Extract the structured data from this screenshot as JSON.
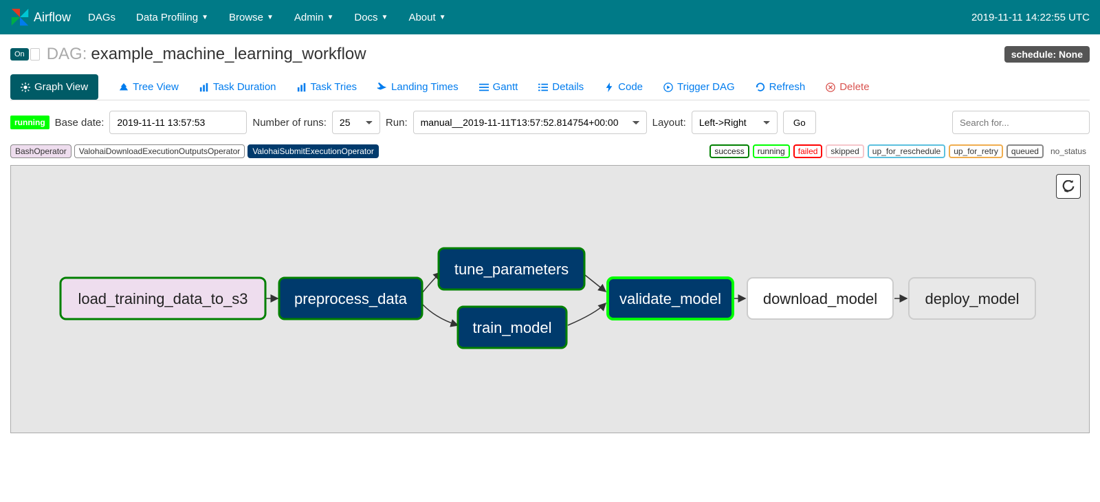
{
  "navbar": {
    "brand": "Airflow",
    "items": [
      "DAGs",
      "Data Profiling",
      "Browse",
      "Admin",
      "Docs",
      "About"
    ],
    "clock": "2019-11-11 14:22:55 UTC"
  },
  "title": {
    "on": "On",
    "dag_label": "DAG:",
    "dag_name": "example_machine_learning_workflow",
    "schedule": "schedule: None"
  },
  "tabs": {
    "graph_view": "Graph View",
    "tree_view": "Tree View",
    "task_duration": "Task Duration",
    "task_tries": "Task Tries",
    "landing_times": "Landing Times",
    "gantt": "Gantt",
    "details": "Details",
    "code": "Code",
    "trigger_dag": "Trigger DAG",
    "refresh": "Refresh",
    "delete": "Delete"
  },
  "controls": {
    "running": "running",
    "base_date_label": "Base date:",
    "base_date": "2019-11-11 13:57:53",
    "num_runs_label": "Number of runs:",
    "num_runs": "25",
    "run_label": "Run:",
    "run": "manual__2019-11-11T13:57:52.814754+00:00",
    "layout_label": "Layout:",
    "layout": "Left->Right",
    "go": "Go",
    "search_placeholder": "Search for..."
  },
  "operators": {
    "bash": "BashOperator",
    "dl": "ValohaiDownloadExecutionOutputsOperator",
    "submit": "ValohaiSubmitExecutionOperator"
  },
  "states": [
    "success",
    "running",
    "failed",
    "skipped",
    "up_for_reschedule",
    "up_for_retry",
    "queued",
    "no_status"
  ],
  "graph": {
    "nodes": {
      "load": "load_training_data_to_s3",
      "preprocess": "preprocess_data",
      "tune": "tune_parameters",
      "train": "train_model",
      "validate": "validate_model",
      "download": "download_model",
      "deploy": "deploy_model"
    }
  }
}
